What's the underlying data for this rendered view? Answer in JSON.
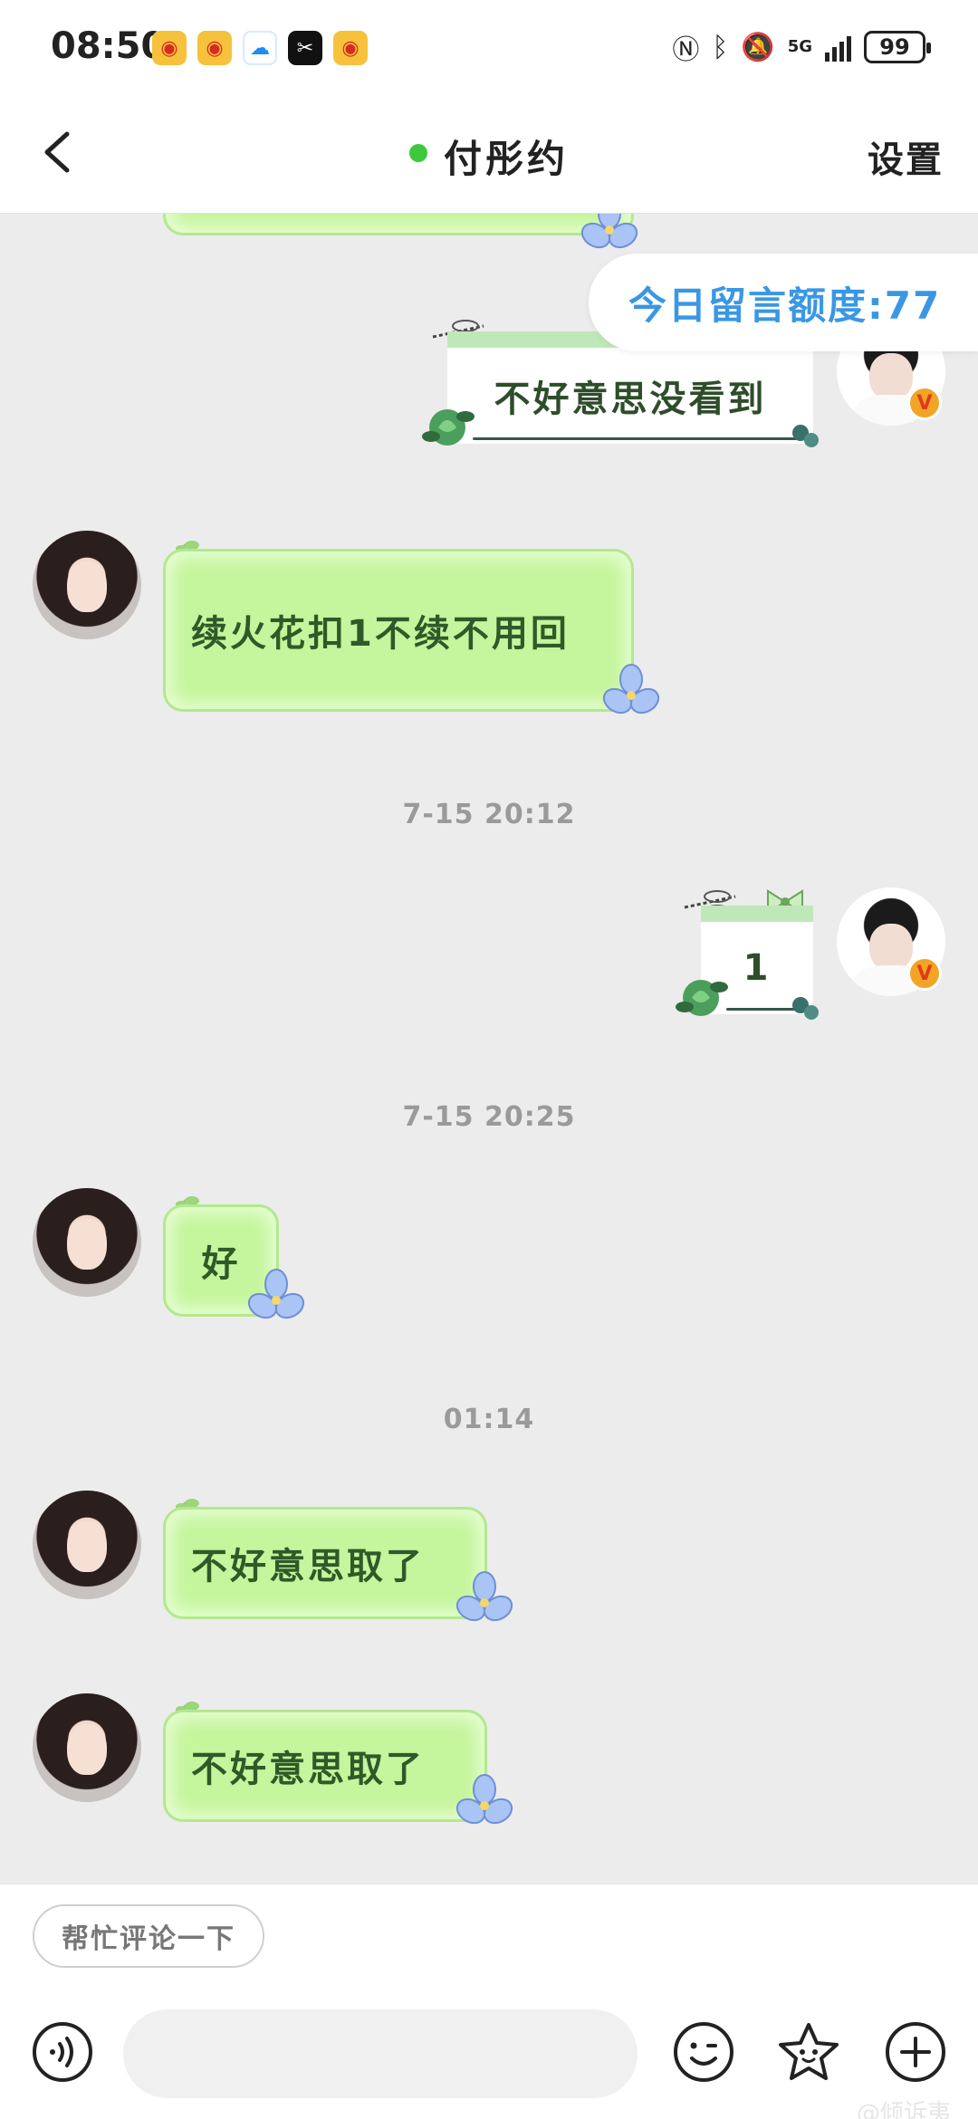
{
  "status_bar": {
    "time": "08:50",
    "network": "5G",
    "battery": "99",
    "app_icons": [
      "weibo-icon",
      "weibo-icon",
      "cloud-app-icon",
      "capcut-icon",
      "weibo-icon"
    ]
  },
  "header": {
    "title": "付彤约",
    "settings_label": "设置",
    "online_color": "#3cc93c"
  },
  "chat": {
    "quota_label": "今日留言额度:77",
    "messages": [
      {
        "side": "out",
        "text": "不好意思没看到"
      },
      {
        "side": "in",
        "text": "续火花扣1不续不用回"
      },
      {
        "type": "time",
        "text": "7-15  20:12"
      },
      {
        "side": "out",
        "text": "1"
      },
      {
        "type": "time",
        "text": "7-15  20:25"
      },
      {
        "side": "in",
        "text": "好"
      },
      {
        "type": "time",
        "text": "01:14"
      },
      {
        "side": "in",
        "text": "不好意思取了"
      },
      {
        "side": "in",
        "text": "不好意思取了"
      }
    ]
  },
  "bottom": {
    "quick_reply": "帮忙评论一下",
    "input_value": "",
    "watermark": "@倾诉夷"
  },
  "colors": {
    "bubble_in": "#c5f59c",
    "text_in": "#2f5a28",
    "quota_text": "#3a97e4"
  }
}
